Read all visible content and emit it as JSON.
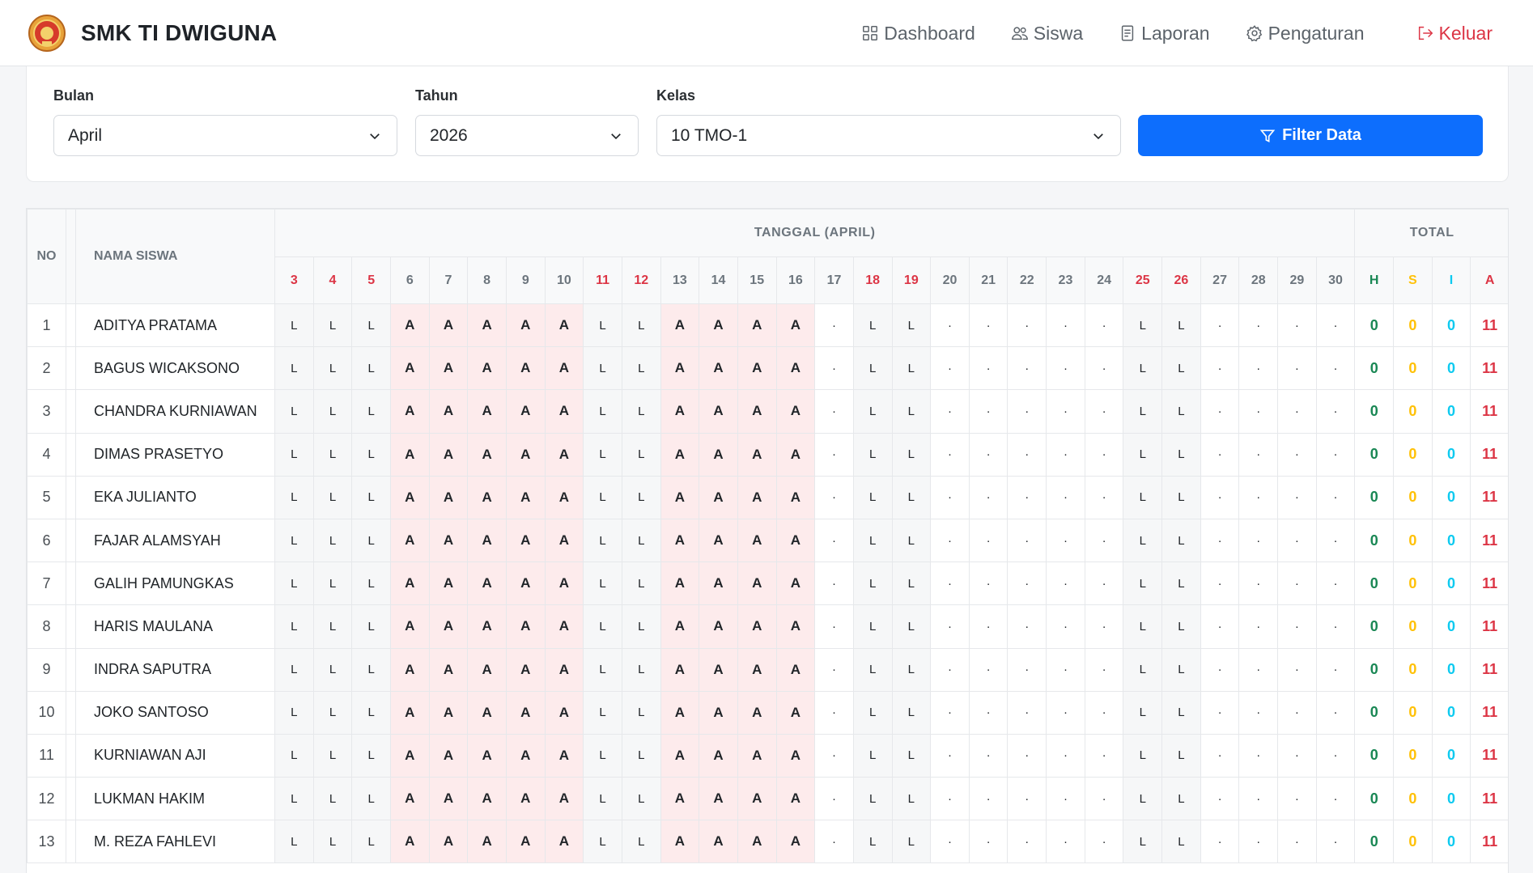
{
  "app": {
    "brand_name": "SMK TI DWIGUNA",
    "logo_icon": "school-emblem-icon"
  },
  "nav": {
    "dashboard": "Dashboard",
    "siswa": "Siswa",
    "laporan": "Laporan",
    "pengaturan": "Pengaturan",
    "keluar": "Keluar"
  },
  "filters": {
    "bulan_label": "Bulan",
    "bulan_value": "April",
    "tahun_label": "Tahun",
    "tahun_value": "2026",
    "kelas_label": "Kelas",
    "kelas_value": "10 TMO-1",
    "button_label": "Filter Data"
  },
  "table": {
    "col_no": "NO",
    "col_name": "NAMA SISWA",
    "col_dates": "TANGGAL (APRIL)",
    "col_total": "TOTAL",
    "days": [
      "3",
      "4",
      "5",
      "6",
      "7",
      "8",
      "9",
      "10",
      "11",
      "12",
      "13",
      "14",
      "15",
      "16",
      "17",
      "18",
      "19",
      "20",
      "21",
      "22",
      "23",
      "24",
      "25",
      "26",
      "27",
      "28",
      "29",
      "30"
    ],
    "weekend_days": [
      "3",
      "4",
      "5",
      "11",
      "12",
      "18",
      "19",
      "25",
      "26"
    ],
    "total_labels": [
      "H",
      "S",
      "I",
      "A"
    ],
    "status_pattern": [
      "L",
      "L",
      "L",
      "A",
      "A",
      "A",
      "A",
      "A",
      "L",
      "L",
      "A",
      "A",
      "A",
      "A",
      "·",
      "L",
      "L",
      "·",
      "·",
      "·",
      "·",
      "·",
      "L",
      "L",
      "·",
      "·",
      "·",
      "·"
    ],
    "rows": [
      {
        "no": "1",
        "name": "ADITYA PRATAMA",
        "h": "0",
        "s": "0",
        "i": "0",
        "a": "11"
      },
      {
        "no": "2",
        "name": "BAGUS WICAKSONO",
        "h": "0",
        "s": "0",
        "i": "0",
        "a": "11"
      },
      {
        "no": "3",
        "name": "CHANDRA KURNIAWAN",
        "h": "0",
        "s": "0",
        "i": "0",
        "a": "11"
      },
      {
        "no": "4",
        "name": "DIMAS PRASETYO",
        "h": "0",
        "s": "0",
        "i": "0",
        "a": "11"
      },
      {
        "no": "5",
        "name": "EKA JULIANTO",
        "h": "0",
        "s": "0",
        "i": "0",
        "a": "11"
      },
      {
        "no": "6",
        "name": "FAJAR ALAMSYAH",
        "h": "0",
        "s": "0",
        "i": "0",
        "a": "11"
      },
      {
        "no": "7",
        "name": "GALIH PAMUNGKAS",
        "h": "0",
        "s": "0",
        "i": "0",
        "a": "11"
      },
      {
        "no": "8",
        "name": "HARIS MAULANA",
        "h": "0",
        "s": "0",
        "i": "0",
        "a": "11"
      },
      {
        "no": "9",
        "name": "INDRA SAPUTRA",
        "h": "0",
        "s": "0",
        "i": "0",
        "a": "11"
      },
      {
        "no": "10",
        "name": "JOKO SANTOSO",
        "h": "0",
        "s": "0",
        "i": "0",
        "a": "11"
      },
      {
        "no": "11",
        "name": "KURNIAWAN AJI",
        "h": "0",
        "s": "0",
        "i": "0",
        "a": "11"
      },
      {
        "no": "12",
        "name": "LUKMAN HAKIM",
        "h": "0",
        "s": "0",
        "i": "0",
        "a": "11"
      },
      {
        "no": "13",
        "name": "M. REZA FAHLEVI",
        "h": "0",
        "s": "0",
        "i": "0",
        "a": "11"
      }
    ]
  },
  "colors": {
    "primary": "#0d6efd",
    "danger": "#dc3545",
    "success": "#198754",
    "warning": "#ffc107",
    "info": "#0dcaf0",
    "absent_bg": "#fdebec"
  }
}
